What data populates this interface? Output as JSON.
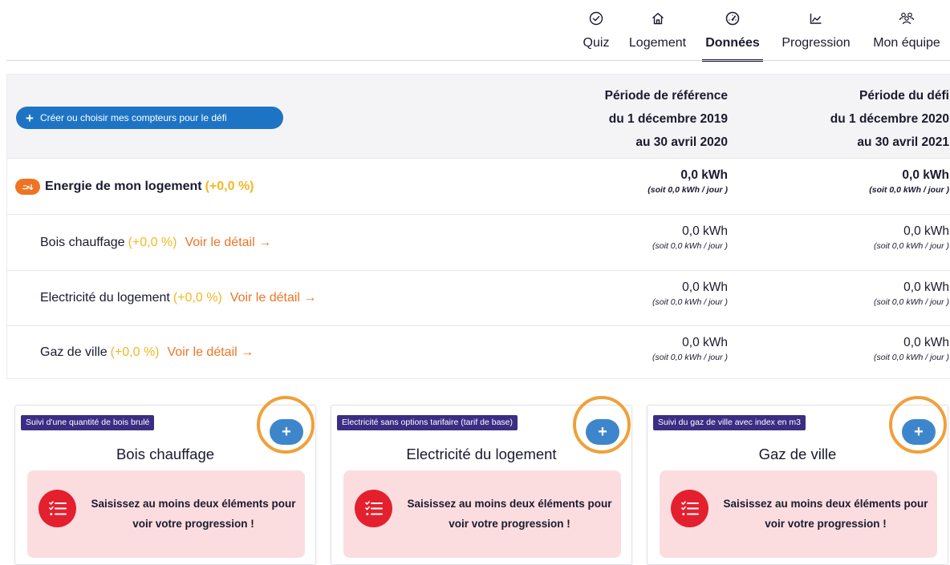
{
  "nav": {
    "items": [
      {
        "label": "Quiz",
        "icon": "check-circle-icon"
      },
      {
        "label": "Logement",
        "icon": "house-icon"
      },
      {
        "label": "Données",
        "icon": "gauge-icon",
        "active": true
      },
      {
        "label": "Progression",
        "icon": "area-chart-icon"
      },
      {
        "label": "Mon équipe",
        "icon": "team-icon"
      }
    ]
  },
  "table": {
    "create_button_label": "Créer ou choisir mes compteurs pour le défi",
    "reference_period": {
      "line1": "Période de référence",
      "line2": "du 1 décembre 2019",
      "line3": "au 30 avril 2020"
    },
    "challenge_period": {
      "line1": "Période du défi",
      "line2": "du 1 décembre 2020",
      "line3": "au 30 avril 2021"
    },
    "main_row": {
      "label": "Energie de mon logement",
      "pct": "(+0,0 %)",
      "ref_value": "0,0 kWh",
      "ref_per_day": "(soit 0,0 kWh / jour )",
      "defi_value": "0,0 kWh",
      "defi_per_day": "(soit 0,0 kWh / jour )"
    },
    "rows": [
      {
        "label": "Bois chauffage",
        "pct": "(+0,0 %)",
        "detail": "Voir le détail",
        "ref_value": "0,0 kWh",
        "ref_per_day": "(soit 0,0 kWh / jour )",
        "defi_value": "0,0 kWh",
        "defi_per_day": "(soit 0,0 kWh / jour )"
      },
      {
        "label": "Electricité du logement",
        "pct": "(+0,0 %)",
        "detail": "Voir le détail",
        "ref_value": "0,0 kWh",
        "ref_per_day": "(soit 0,0 kWh / jour )",
        "defi_value": "0,0 kWh",
        "defi_per_day": "(soit 0,0 kWh / jour )"
      },
      {
        "label": "Gaz de ville",
        "pct": "(+0,0 %)",
        "detail": "Voir le détail",
        "ref_value": "0,0 kWh",
        "ref_per_day": "(soit 0,0 kWh / jour )",
        "defi_value": "0,0 kWh",
        "defi_per_day": "(soit 0,0 kWh / jour )"
      }
    ]
  },
  "cards": [
    {
      "chip": "Suivi d'une quantité de bois brulé",
      "title": "Bois chauffage",
      "message": "Saisissez au moins deux éléments pour voir votre progression !",
      "add_label": "+"
    },
    {
      "chip": "Electricité sans options tarifaire (tarif de base)",
      "title": "Electricité du logement",
      "message": "Saisissez au moins deux éléments pour voir votre progression !",
      "add_label": "+"
    },
    {
      "chip": "Suivi du gaz de ville avec index en m3",
      "title": "Gaz de ville",
      "message": "Saisissez au moins deux éléments pour voir votre progression !",
      "add_label": "+"
    }
  ],
  "colors": {
    "primary_blue": "#1e74c4",
    "accent_orange": "#ee7424",
    "percent_yellow": "#f2b824",
    "chip_purple": "#3b2d83",
    "warning_red": "#e4202e",
    "warning_bg": "#fbdde0",
    "highlight_ring": "#f0a03a"
  }
}
